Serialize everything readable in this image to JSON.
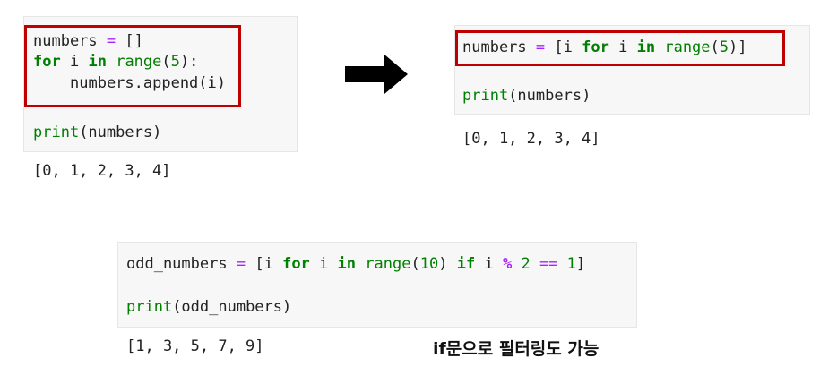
{
  "left_example": {
    "line1": {
      "var": "numbers",
      "op": "=",
      "val": "[]"
    },
    "line2": {
      "kw_for": "for",
      "var": "i",
      "kw_in": "in",
      "fn": "range",
      "open": "(",
      "arg": "5",
      "close": "):"
    },
    "line3": {
      "text": "numbers.append(i)"
    },
    "print_line": {
      "fn": "print",
      "args": "(numbers)"
    },
    "output": "[0, 1, 2, 3, 4]"
  },
  "right_example": {
    "line1": {
      "var": "numbers",
      "op": "=",
      "open": "[i",
      "kw_for": "for",
      "var2": "i",
      "kw_in": "in",
      "fn": "range",
      "paren_open": "(",
      "arg": "5",
      "close": ")]"
    },
    "print_line": {
      "fn": "print",
      "args": "(numbers)"
    },
    "output": "[0, 1, 2, 3, 4]"
  },
  "bottom_example": {
    "line1": {
      "var": "odd_numbers",
      "op": "=",
      "open": "[i",
      "kw_for": "for",
      "var2": "i",
      "kw_in": "in",
      "fn": "range",
      "paren_open": "(",
      "arg": "10",
      "paren_close": ")",
      "kw_if": "if",
      "var3": "i",
      "mod": "%",
      "two": "2",
      "eq": "==",
      "one": "1",
      "close": "]"
    },
    "print_line": {
      "fn": "print",
      "args": "(odd_numbers)"
    },
    "output": "[1, 3, 5, 7, 9]"
  },
  "arrow_icon": "right-arrow-icon",
  "annotation": "if문으로 필터링도 가능",
  "colors": {
    "keyword": "#008000",
    "operator": "#aa22ff",
    "highlight": "#c00000",
    "cell_bg": "#f7f7f7"
  }
}
